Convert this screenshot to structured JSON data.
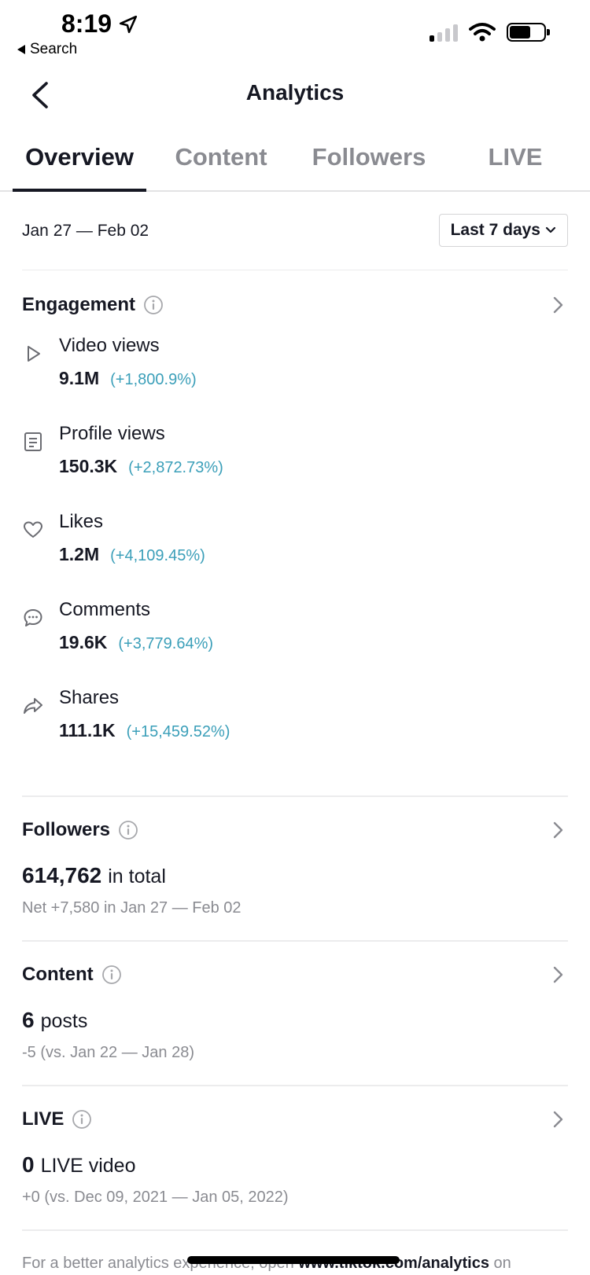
{
  "status_bar": {
    "time": "8:19",
    "back_label": "Search"
  },
  "header": {
    "title": "Analytics"
  },
  "tabs": [
    {
      "label": "Overview",
      "active": true
    },
    {
      "label": "Content",
      "active": false
    },
    {
      "label": "Followers",
      "active": false
    },
    {
      "label": "LIVE",
      "active": false
    }
  ],
  "date_range": {
    "label": "Jan 27 — Feb 02",
    "select_value": "Last 7 days"
  },
  "engagement": {
    "title": "Engagement",
    "metrics": [
      {
        "icon": "play-icon",
        "label": "Video views",
        "value": "9.1M",
        "change": "(+1,800.9%)"
      },
      {
        "icon": "profile-icon",
        "label": "Profile views",
        "value": "150.3K",
        "change": "(+2,872.73%)"
      },
      {
        "icon": "heart-icon",
        "label": "Likes",
        "value": "1.2M",
        "change": "(+4,109.45%)"
      },
      {
        "icon": "comment-icon",
        "label": "Comments",
        "value": "19.6K",
        "change": "(+3,779.64%)"
      },
      {
        "icon": "share-icon",
        "label": "Shares",
        "value": "111.1K",
        "change": "(+15,459.52%)"
      }
    ]
  },
  "followers": {
    "title": "Followers",
    "total": "614,762",
    "total_suffix": "in total",
    "subtitle": "Net +7,580 in Jan 27 — Feb 02"
  },
  "content": {
    "title": "Content",
    "total": "6",
    "total_suffix": "posts",
    "subtitle": "-5 (vs. Jan 22 — Jan 28)"
  },
  "live": {
    "title": "LIVE",
    "total": "0",
    "total_suffix": "LIVE video",
    "subtitle": "+0 (vs. Dec 09, 2021 — Jan 05, 2022)"
  },
  "footer": {
    "text_before": "For a better analytics experience, open ",
    "link": "www.tiktok.com/analytics",
    "text_after": " on"
  },
  "colors": {
    "accent_change": "#3b9fb9",
    "text_primary": "#161823",
    "text_secondary": "#8a8b91"
  }
}
